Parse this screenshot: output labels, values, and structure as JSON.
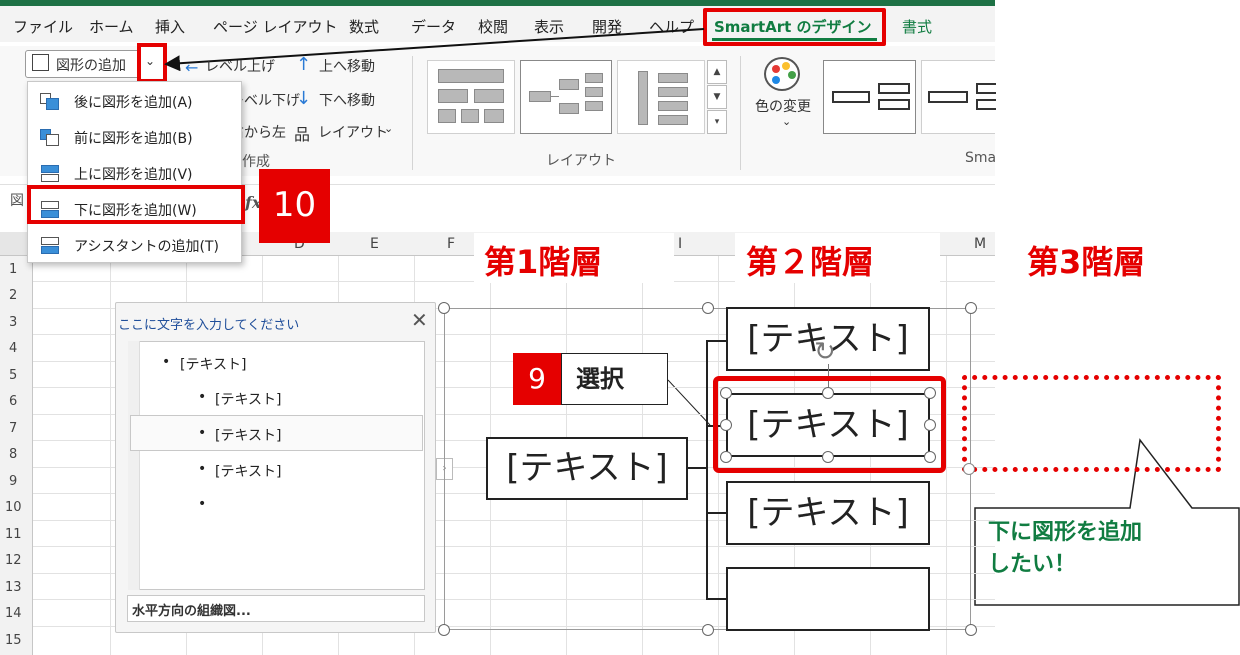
{
  "menu": {
    "items": [
      "ファイル",
      "ホーム",
      "挿入",
      "ページ レイアウト",
      "数式",
      "データ",
      "校閲",
      "表示",
      "開発",
      "ヘルプ"
    ],
    "smartart_tab": "SmartArt のデザイン",
    "format_tab": "書式"
  },
  "ribbon": {
    "add_shape": "図形の追加",
    "level_up": "レベル上げ",
    "level_down": "レベル下げ",
    "right_to_left_fragment": "右から左",
    "create_group_fragment": "作成",
    "move_up": "上へ移動",
    "move_down": "下へ移動",
    "layout_btn": "レイアウト",
    "layouts_group": "レイアウト",
    "change_color": "色の変更",
    "styles_group_fragment": "Sma"
  },
  "dropdown": {
    "items": [
      "後に図形を追加(A)",
      "前に図形を追加(B)",
      "上に図形を追加(V)",
      "下に図形を追加(W)",
      "アシスタントの追加(T)"
    ]
  },
  "formula": {
    "name_stub": "図",
    "fx": "fx"
  },
  "columns": [
    "D",
    "E",
    "F",
    "I",
    "M"
  ],
  "rows": [
    "1",
    "2",
    "3",
    "4",
    "5",
    "6",
    "7",
    "8",
    "9",
    "10",
    "11",
    "12",
    "13",
    "14",
    "15"
  ],
  "levels": {
    "level1": "第1階層",
    "level2": "第２階層",
    "level3": "第3階層"
  },
  "text_pane": {
    "title": "ここに文字を入力してください",
    "close": "✕",
    "items": [
      "[テキスト]",
      "[テキスト]",
      "[テキスト]",
      "[テキスト]",
      ""
    ],
    "footer": "水平方向の組織図..."
  },
  "nodes": {
    "root": "[テキスト]",
    "child1": "[テキスト]",
    "child2": "[テキスト]",
    "child3": "[テキスト]",
    "child4": ""
  },
  "steps": {
    "step9_num": "9",
    "step9_label": "選択",
    "step10_num": "10"
  },
  "callout": {
    "line1": "下に図形を追加",
    "line2": "したい！"
  },
  "colors": {
    "accent_red": "#e50000",
    "excel_green": "#107c41"
  }
}
